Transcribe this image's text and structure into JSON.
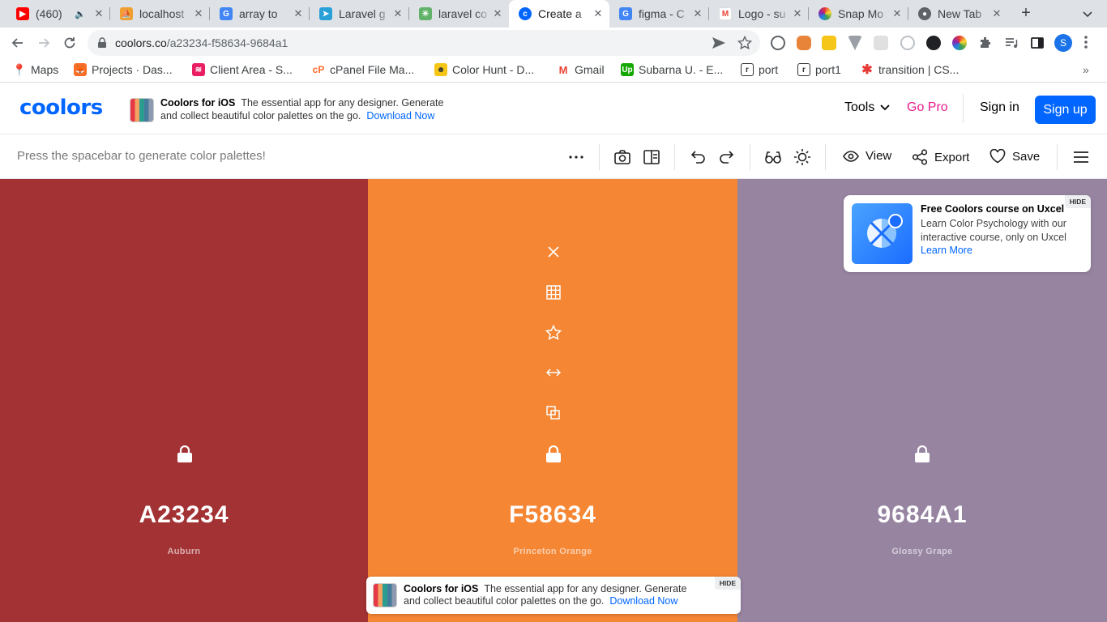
{
  "browser": {
    "tabs": [
      {
        "title": "(460)",
        "icon": "youtube-icon",
        "audio": true
      },
      {
        "title": "localhost",
        "icon": "phpmyadmin-icon"
      },
      {
        "title": "array to",
        "icon": "google-icon"
      },
      {
        "title": "Laravel g",
        "icon": "telegram-icon"
      },
      {
        "title": "laravel co",
        "icon": "laracasts-icon"
      },
      {
        "title": "Create a",
        "icon": "coolors-icon",
        "active": true
      },
      {
        "title": "figma - C",
        "icon": "google-icon"
      },
      {
        "title": "Logo - su",
        "icon": "gmail-icon"
      },
      {
        "title": "Snap Mo",
        "icon": "snap-icon"
      },
      {
        "title": "New Tab",
        "icon": "chrome-icon"
      }
    ],
    "url_domain": "coolors.co",
    "url_path": "/a23234-f58634-9684a1",
    "profile_initial": "S",
    "bookmarks": [
      {
        "label": "Maps",
        "icon": "maps-pin-icon"
      },
      {
        "label": "Projects · Das...",
        "icon": "gitlab-icon"
      },
      {
        "label": "Client Area - S...",
        "icon": "stack-icon"
      },
      {
        "label": "cPanel File Ma...",
        "icon": "cpanel-icon"
      },
      {
        "label": "Color Hunt - D...",
        "icon": "colorhunt-icon"
      },
      {
        "label": "Gmail",
        "icon": "gmail-icon"
      },
      {
        "label": "Subarna U. - E...",
        "icon": "upwork-icon"
      },
      {
        "label": "port",
        "icon": "bookmark-r-icon"
      },
      {
        "label": "port1",
        "icon": "bookmark-r-icon"
      },
      {
        "label": "transition | CS...",
        "icon": "asterisk-icon"
      }
    ]
  },
  "header": {
    "logo": "coolors",
    "ios_promo_title": "Coolors for iOS",
    "ios_promo_text1": "The essential app for any designer. Generate",
    "ios_promo_text2": "and collect beautiful color palettes on the go.",
    "ios_promo_link": "Download Now",
    "tools_label": "Tools",
    "gopro_label": "Go Pro",
    "signin_label": "Sign in",
    "signup_label": "Sign up"
  },
  "toolbar": {
    "hint": "Press the spacebar to generate color palettes!",
    "view_label": "View",
    "export_label": "Export",
    "save_label": "Save"
  },
  "palette": [
    {
      "hex": "A23234",
      "name": "Auburn",
      "color": "#A23234"
    },
    {
      "hex": "F58634",
      "name": "Princeton Orange",
      "color": "#F58634"
    },
    {
      "hex": "9684A1",
      "name": "Glossy Grape",
      "color": "#9684A1"
    }
  ],
  "uxcel_card": {
    "title": "Free Coolors course on Uxcel",
    "desc": "Learn Color Psychology with our interactive course, only on Uxcel",
    "link": "Learn More",
    "hide": "HIDE"
  },
  "bottom_promo": {
    "title": "Coolors for iOS",
    "text1": "The essential app for any designer. Generate",
    "text2": "and collect beautiful color palettes on the go.",
    "link": "Download Now",
    "hide": "HIDE"
  }
}
